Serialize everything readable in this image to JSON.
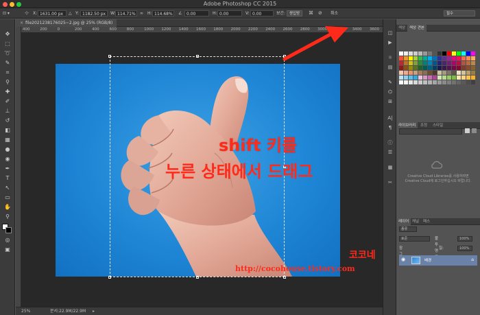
{
  "app": {
    "title": "Adobe Photoshop CC 2015"
  },
  "options": {
    "x_label": "X:",
    "x_value": "1631.00 px",
    "y_label": "Y:",
    "y_value": "1182.50 px",
    "w_label": "W:",
    "w_value": "114.71%",
    "h_label": "H:",
    "h_value": "114.68%",
    "angle_value": "0.00",
    "hskew_label": "H:",
    "hskew_value": "0.00",
    "vskew_label": "V:",
    "vskew_value": "0.00",
    "interp_label": "보간:",
    "interp_value": "쌍입방",
    "cancel_label": "취소",
    "workspace_label": "필수"
  },
  "document": {
    "tab_title": "file2021238176025~2.jpg @ 25% (RGB/8)",
    "close_glyph": "×"
  },
  "ruler": {
    "ticks": [
      "400",
      "200",
      "0",
      "200",
      "400",
      "600",
      "800",
      "1000",
      "1200",
      "1400",
      "1600",
      "1800",
      "2000",
      "2200",
      "2400",
      "2600",
      "2800",
      "3000",
      "3200",
      "3400",
      "3600"
    ]
  },
  "canvas_text": {
    "line1": "shift 키를",
    "line2": "누른 상태에서 드래그",
    "watermark_name": "코코네",
    "watermark_url": "http://cocohouse.tistory.com"
  },
  "status": {
    "zoom": "25%",
    "doc_info": "문서:22.9M/22.9M"
  },
  "panels": {
    "top_tabs": [
      "색상",
      "색상 견본"
    ],
    "library_tabs": [
      "라이브러리",
      "조정",
      "스타일"
    ],
    "library_msg1": "Creative Cloud Libraries를 사용하려면",
    "library_msg2": "Creative Cloud에 로그인하십시오 바랍니다.",
    "layer_tabs": [
      "레이어",
      "채널",
      "패스"
    ],
    "kind_label": "종류",
    "blend_mode": "표준",
    "opacity_label": "불투명도:",
    "opacity_value": "100%",
    "lock_label": "잠그기:",
    "fill_label": "칠:",
    "fill_value": "100%",
    "layer_name": "배경"
  },
  "colors": {
    "accent_red": "#ff2a1a",
    "sky": "#1f86d6",
    "panel_bg": "#535353",
    "selected_layer": "#6a82a8"
  }
}
